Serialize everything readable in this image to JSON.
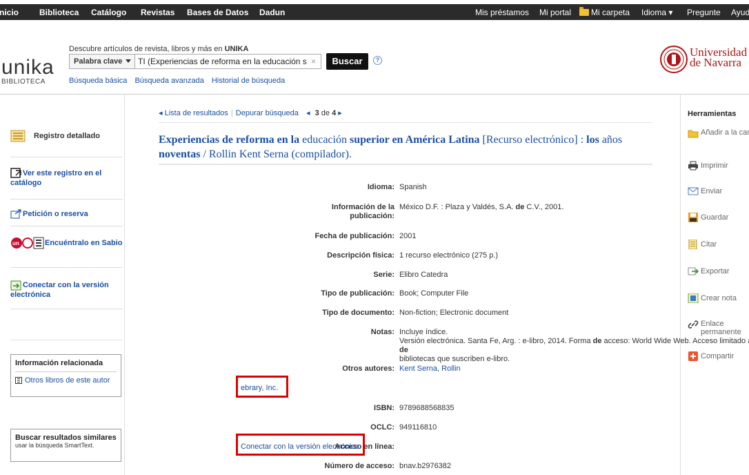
{
  "topnav": {
    "left": [
      "nicio",
      "Biblioteca",
      "Catálogo",
      "Revistas",
      "Bases de Datos",
      "Dadun"
    ],
    "right": [
      "Mis préstamos",
      "Mi portal",
      "Mi carpeta",
      "Idioma ▾",
      "Pregunte",
      "Ayud"
    ]
  },
  "header": {
    "logo": "unika",
    "logo_sub": "BIBLIOTECA",
    "tagline_prefix": "Descubre artículos de revista, libros y más en ",
    "tagline_brand": "UNIKA",
    "search_type": "Palabra clave",
    "search_value": "TI (Experiencias de reforma en la educación s",
    "clear": "×",
    "search_button": "Buscar",
    "help": "?",
    "links": [
      "Búsqueda básica",
      "Búsqueda avanzada",
      "Historial de búsqueda"
    ],
    "university_line1": "Universidad",
    "university_line2": "de Navarra"
  },
  "sidebar": {
    "registro": "Registro detallado",
    "ver_catalogo": "Ver este registro en el catálogo",
    "peticion": "Petición o reserva",
    "encuentralo": "Encuéntralo en Sabio",
    "conectar": "Conectar con la versión electrónica",
    "info_title": "Información relacionada",
    "info_link": "Otros libros de este autor",
    "similar_title": "Buscar resultados similares",
    "similar_sub": "usar la búsqueda SmartText."
  },
  "pager": {
    "lista": "◂ Lista de resultados",
    "depurar": "Depurar búsqueda",
    "prev": "◂",
    "pos": "3",
    "of": "de",
    "total": "4",
    "next": "▸"
  },
  "record": {
    "title_parts": [
      {
        "t": "Experiencias de reforma en la",
        "b": true
      },
      {
        "t": " educación ",
        "b": false
      },
      {
        "t": "superior en América Latina",
        "b": true
      },
      {
        "t": " [Recurso electrónico] : ",
        "b": false
      },
      {
        "t": "los",
        "b": true
      },
      {
        "t": " años ",
        "b": false
      },
      {
        "t": "noventas",
        "b": true
      },
      {
        "t": " / Rollin Kent Serna (compilador).",
        "b": false
      }
    ],
    "fields": {
      "idioma_label": "Idioma:",
      "idioma": "Spanish",
      "pub_label_1": "Información de la",
      "pub_label_2": "publicación:",
      "pub_pre": "México D.F. : Plaza y Valdés, S.A. ",
      "pub_de": "de",
      "pub_post": " C.V., 2001.",
      "fecha_label": "Fecha de publicación:",
      "fecha": "2001",
      "desc_label": "Descripción física:",
      "desc": "1 recurso electrónico (275 p.)",
      "serie_label": "Serie:",
      "serie": "Elibro Catedra",
      "tipo_pub_label": "Tipo de publicación:",
      "tipo_pub": "Book; Computer File",
      "tipo_doc_label": "Tipo de documento:",
      "tipo_doc": "Non-fiction; Electronic document",
      "notas_label": "Notas:",
      "notas_1": "Incluye índice.",
      "notas_2_pre": "Versión electrónica. Santa Fe, Arg. : e-libro, 2014. Forma ",
      "notas_2_de1": "de",
      "notas_2_mid": " acceso: World Wide Web. Acceso limitado a usuarios ",
      "notas_2_de2": "de",
      "notas_3": "bibliotecas que suscriben e-libro.",
      "autores_label": "Otros autores:",
      "autor_1": "Kent Serna, Rollin",
      "autor_2": "ebrary, Inc.",
      "isbn_label": "ISBN:",
      "isbn": "9789688568835",
      "oclc_label": "OCLC:",
      "oclc": "949116810",
      "acceso_label": "Acceso en línea:",
      "acceso": "Conectar con la versión electrónica",
      "numero_label": "Número de acceso:",
      "numero": "bnav.b2976382"
    }
  },
  "tools": {
    "head": "Herramientas",
    "items": [
      "Añadir a la carpeta",
      "Imprimir",
      "Enviar",
      "Guardar",
      "Citar",
      "Exportar",
      "Crear nota",
      "Enlace permanente",
      "Compartir"
    ]
  }
}
